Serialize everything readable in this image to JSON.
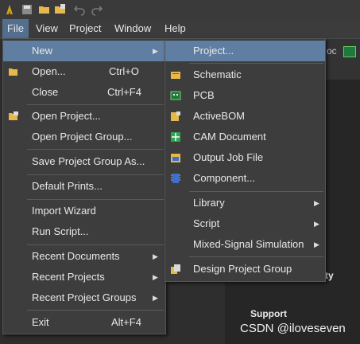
{
  "menubar": {
    "items": [
      {
        "label": "File"
      },
      {
        "label": "View"
      },
      {
        "label": "Project"
      },
      {
        "label": "Window"
      },
      {
        "label": "Help"
      }
    ]
  },
  "file_menu": {
    "items": [
      {
        "label": "New",
        "shortcut": "",
        "submenu": true,
        "icon": ""
      },
      {
        "label": "Open...",
        "shortcut": "Ctrl+O",
        "submenu": false,
        "icon": "folder-open-icon"
      },
      {
        "label": "Close",
        "shortcut": "Ctrl+F4",
        "submenu": false,
        "icon": ""
      },
      {
        "label": "Open Project...",
        "shortcut": "",
        "submenu": false,
        "icon": "open-project-icon"
      },
      {
        "label": "Open Project Group...",
        "shortcut": "",
        "submenu": false,
        "icon": ""
      },
      {
        "label": "Save Project Group As...",
        "shortcut": "",
        "submenu": false,
        "icon": ""
      },
      {
        "label": "Default Prints...",
        "shortcut": "",
        "submenu": false,
        "icon": ""
      },
      {
        "label": "Import Wizard",
        "shortcut": "",
        "submenu": false,
        "icon": ""
      },
      {
        "label": "Run Script...",
        "shortcut": "",
        "submenu": false,
        "icon": ""
      },
      {
        "label": "Recent Documents",
        "shortcut": "",
        "submenu": true,
        "icon": ""
      },
      {
        "label": "Recent Projects",
        "shortcut": "",
        "submenu": true,
        "icon": ""
      },
      {
        "label": "Recent Project Groups",
        "shortcut": "",
        "submenu": true,
        "icon": ""
      },
      {
        "label": "Exit",
        "shortcut": "Alt+F4",
        "submenu": false,
        "icon": ""
      }
    ]
  },
  "new_menu": {
    "items": [
      {
        "label": "Project...",
        "submenu": false,
        "icon": ""
      },
      {
        "label": "Schematic",
        "submenu": false,
        "icon": "schematic-icon"
      },
      {
        "label": "PCB",
        "submenu": false,
        "icon": "pcb-icon"
      },
      {
        "label": "ActiveBOM",
        "submenu": false,
        "icon": "activebom-icon"
      },
      {
        "label": "CAM Document",
        "submenu": false,
        "icon": "cam-document-icon"
      },
      {
        "label": "Output Job File",
        "submenu": false,
        "icon": "output-job-icon"
      },
      {
        "label": "Component...",
        "submenu": false,
        "icon": "component-icon"
      },
      {
        "label": "Library",
        "submenu": true,
        "icon": ""
      },
      {
        "label": "Script",
        "submenu": true,
        "icon": ""
      },
      {
        "label": "Mixed-Signal Simulation",
        "submenu": true,
        "icon": ""
      },
      {
        "label": "Design Project Group",
        "submenu": false,
        "icon": "project-group-icon"
      }
    ]
  },
  "background": {
    "tab_fragment": "oc",
    "right_fragment": "ty",
    "support_label": "Support"
  },
  "watermark": "CSDN @iloveseven",
  "colors": {
    "highlight": "#5f7ea2",
    "menubar_active": "#546f8e",
    "menu_bg": "#3d3d3d"
  }
}
